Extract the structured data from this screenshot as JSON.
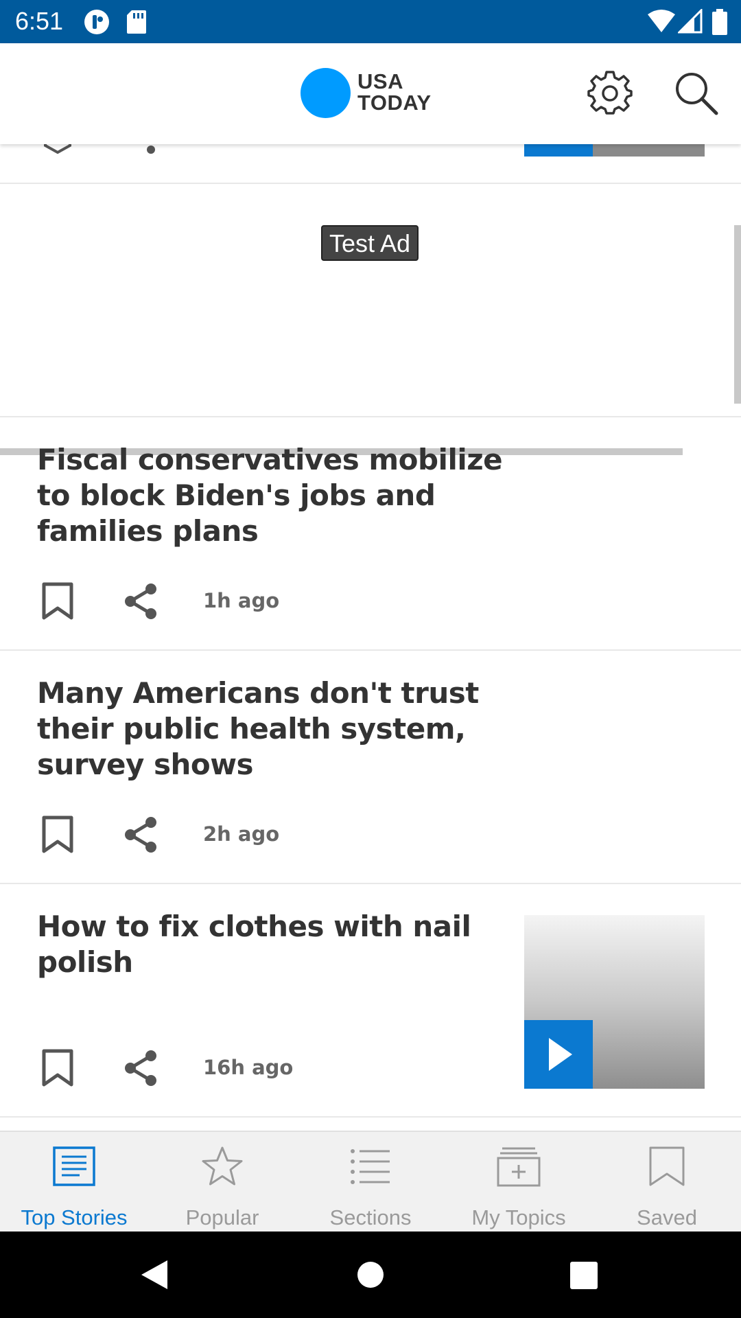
{
  "status_bar": {
    "time": "6:51",
    "icons": [
      "notification-icon",
      "sd-card-icon",
      "wifi-icon",
      "signal-icon",
      "battery-icon"
    ]
  },
  "app_bar": {
    "logo": {
      "line1": "USA",
      "line2": "TODAY"
    },
    "icons": [
      "settings-icon",
      "search-icon"
    ]
  },
  "ad": {
    "label": "Test Ad"
  },
  "stories": [
    {
      "title": "Fiscal conservatives mobilize to block Biden's jobs and families plans",
      "time": "1h ago",
      "has_video": false
    },
    {
      "title": "Many Americans don't trust their public health system, survey shows",
      "time": "2h ago",
      "has_video": false
    },
    {
      "title": "How to fix clothes with nail polish",
      "time": "16h ago",
      "has_video": true
    }
  ],
  "bottom_nav": {
    "items": [
      {
        "label": "Top Stories",
        "icon": "newspaper-icon",
        "active": true
      },
      {
        "label": "Popular",
        "icon": "star-icon",
        "active": false
      },
      {
        "label": "Sections",
        "icon": "list-icon",
        "active": false
      },
      {
        "label": "My Topics",
        "icon": "topics-icon",
        "active": false
      },
      {
        "label": "Saved",
        "icon": "bookmark-icon",
        "active": false
      }
    ]
  },
  "colors": {
    "status_bar": "#005a9c",
    "logo_blue": "#009bff",
    "accent": "#0b79d0",
    "nav_inactive": "#9a9a9a"
  }
}
